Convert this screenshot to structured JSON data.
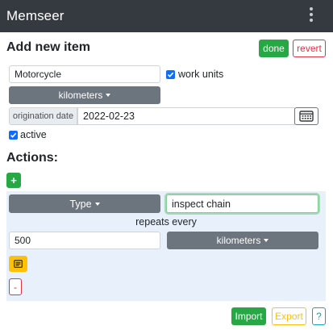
{
  "app": {
    "title": "Memseer"
  },
  "header": {
    "menu_icon": "vertical-ellipsis-icon"
  },
  "form": {
    "title": "Add new item",
    "done_label": "done",
    "revert_label": "revert",
    "name_value": "Motorcycle",
    "work_units": {
      "checked": true,
      "label": "work units"
    },
    "units_dropdown_label": "kilometers",
    "origination_date": {
      "label": "origination date",
      "value": "2022-02-23",
      "icon": "calendar-icon"
    },
    "active": {
      "checked": true,
      "label": "active"
    }
  },
  "actions": {
    "title": "Actions:",
    "add_label": "+",
    "items": [
      {
        "type_dropdown_label": "Type",
        "name_value": "inspect chain",
        "repeats_label": "repeats every",
        "interval_value": "500",
        "interval_units_label": "kilometers",
        "note_icon": "note-icon",
        "remove_label": "-"
      }
    ]
  },
  "footer": {
    "import_label": "Import",
    "export_label": "Export",
    "help_label": "?"
  },
  "colors": {
    "navbar": "#343a40",
    "success": "#28a745",
    "danger": "#dc3545",
    "warning": "#ffc107",
    "info": "#17a2b8",
    "secondary": "#6c757d",
    "checkbox": "#0d6efd",
    "action_panel": "#e8f1fb"
  }
}
